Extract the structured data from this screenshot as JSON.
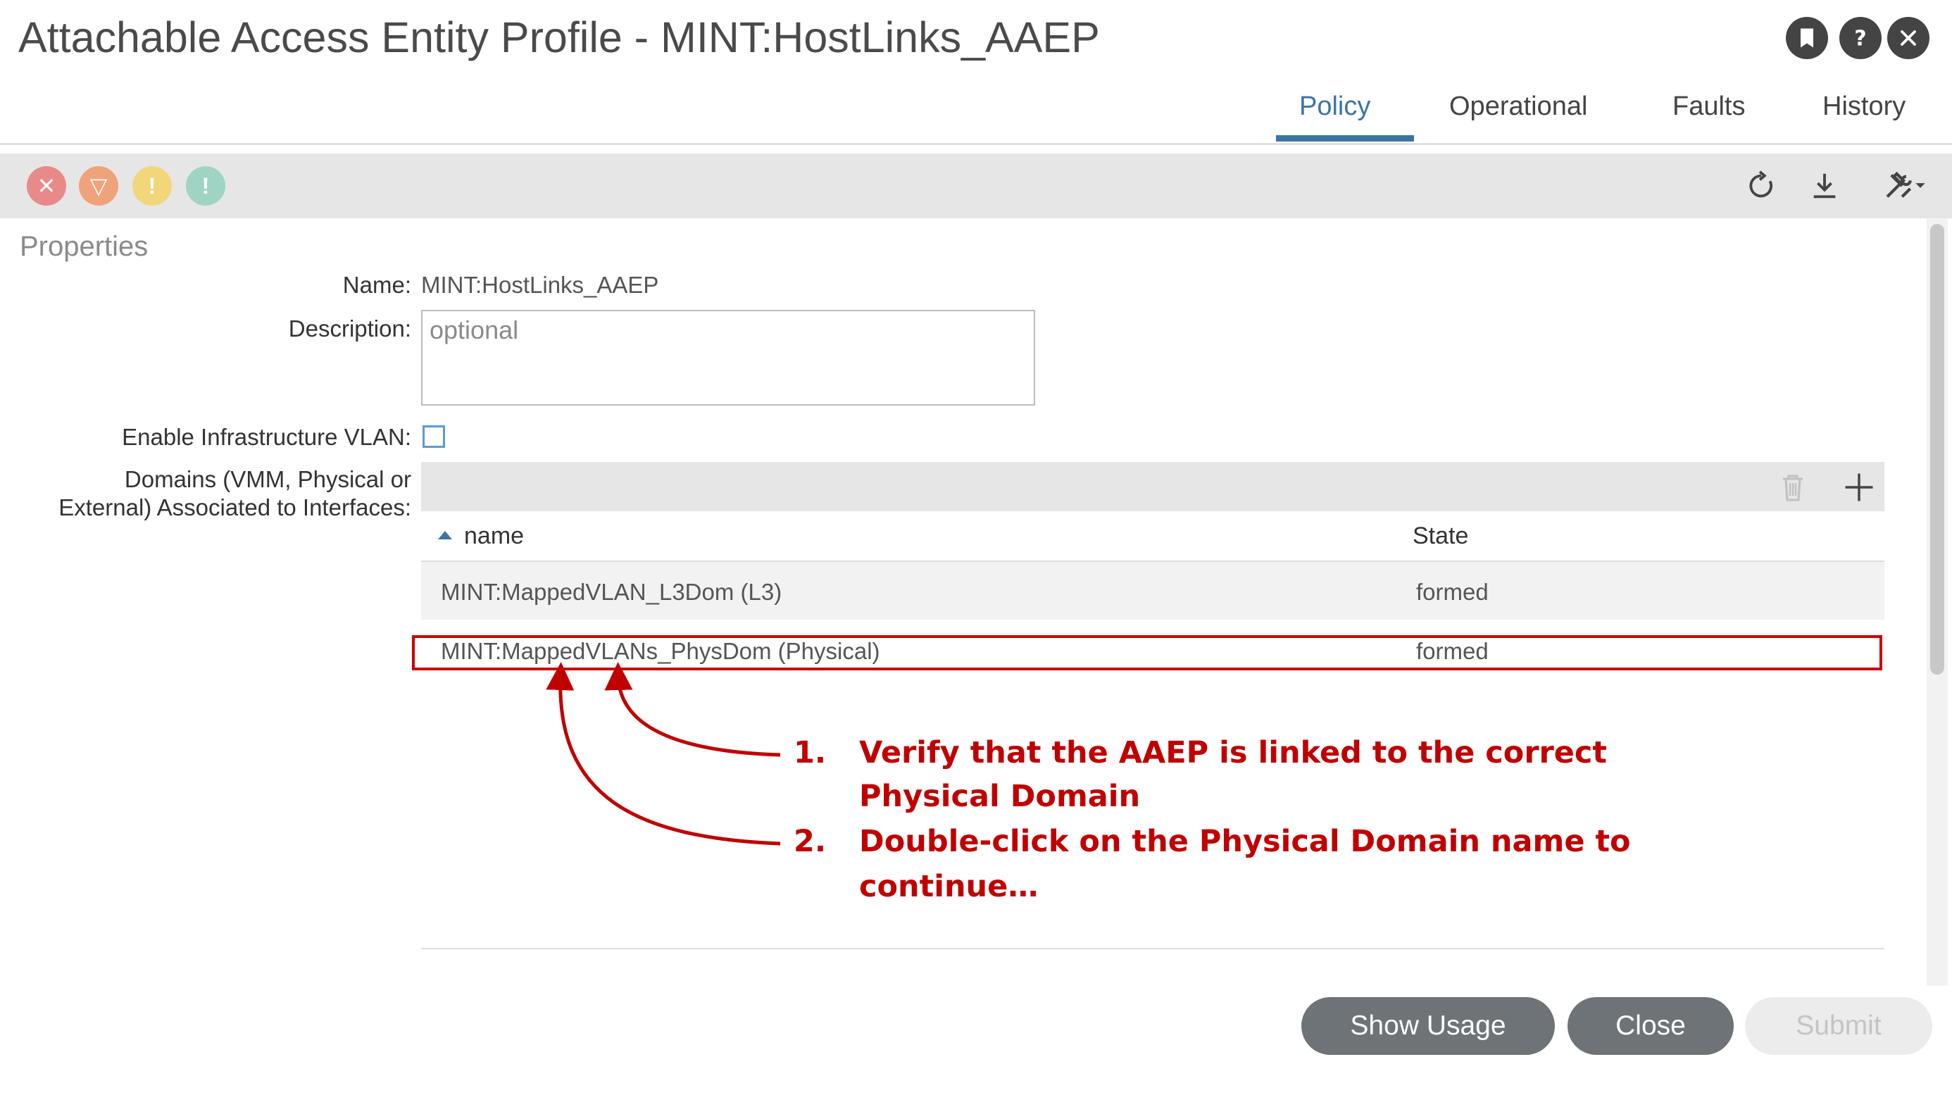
{
  "window": {
    "title": "Attachable Access Entity Profile - MINT:HostLinks_AAEP",
    "icons": [
      "bookmark-icon",
      "help-icon",
      "close-icon"
    ]
  },
  "tabs": [
    {
      "label": "Policy",
      "active": true
    },
    {
      "label": "Operational",
      "active": false
    },
    {
      "label": "Faults",
      "active": false
    },
    {
      "label": "History",
      "active": false
    }
  ],
  "toolbar": {
    "fault_icons": [
      {
        "name": "critical-fault-icon",
        "color": "#e88a8a",
        "glyph": "✕"
      },
      {
        "name": "major-fault-icon",
        "color": "#f0a27a",
        "glyph": "▽"
      },
      {
        "name": "minor-fault-icon",
        "color": "#f2d77a",
        "glyph": "!"
      },
      {
        "name": "warning-fault-icon",
        "color": "#9fd4c4",
        "glyph": "!"
      }
    ],
    "tools": [
      "refresh-icon",
      "download-icon",
      "tools-icon"
    ]
  },
  "properties": {
    "section_title": "Properties",
    "name_label": "Name:",
    "name_value": "MINT:HostLinks_AAEP",
    "description_label": "Description:",
    "description_placeholder": "optional",
    "infra_vlan_label": "Enable Infrastructure VLAN:",
    "infra_vlan_checked": false,
    "domains_label_line1": "Domains (VMM, Physical or",
    "domains_label_line2": "External) Associated to Interfaces:"
  },
  "domains_table": {
    "columns": [
      "name",
      "State"
    ],
    "rows": [
      {
        "name": "MINT:MappedVLAN_L3Dom (L3)",
        "state": "formed"
      },
      {
        "name": "MINT:MappedVLANs_PhysDom (Physical)",
        "state": "formed"
      }
    ],
    "highlight_color": "#cc0000"
  },
  "annotations": [
    {
      "number": "1.",
      "line1": "Verify that the AAEP is linked to the correct",
      "line2": "Physical Domain"
    },
    {
      "number": "2.",
      "line1": "Double-click on the Physical Domain name to",
      "line2": "continue…"
    }
  ],
  "footer": {
    "show_usage_label": "Show Usage",
    "close_label": "Close",
    "submit_label": "Submit"
  }
}
